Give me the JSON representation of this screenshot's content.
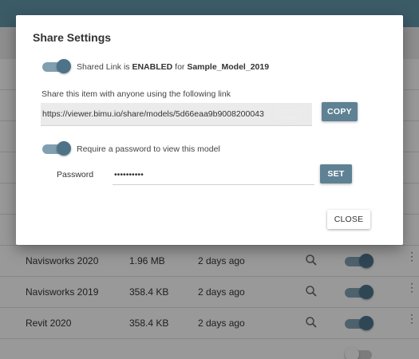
{
  "dialog": {
    "title": "Share Settings",
    "shared_status_prefix": "Shared Link is ",
    "shared_status_state": "ENABLED",
    "shared_status_mid": " for ",
    "model_name": "Sample_Model_2019",
    "share_hint": "Share this item with anyone using the following link",
    "share_link": "https://viewer.bimu.io/share/models/5d66eaa9b9008200043",
    "copy_label": "COPY",
    "password_toggle_label": "Require a password to view this model",
    "password_label": "Password",
    "password_value": "••••••••••",
    "set_label": "SET",
    "close_label": "CLOSE"
  },
  "background_rows": [
    {
      "name": "Navisworks 2020",
      "size": "1.96 MB",
      "date": "2 days ago",
      "toggle_on": true
    },
    {
      "name": "Navisworks 2019",
      "size": "358.4 KB",
      "date": "2 days ago",
      "toggle_on": true
    },
    {
      "name": "Revit 2020",
      "size": "358.4 KB",
      "date": "2 days ago",
      "toggle_on": true
    }
  ],
  "colors": {
    "accent": "#5f8194",
    "topbar": "#5f93a7",
    "toggle_thumb": "#4e7389",
    "toggle_track": "#809fb1",
    "dialog_bg": "#ffffff",
    "link_bg": "#ebebeb"
  },
  "icons": {
    "row_search": "magnifier-icon",
    "row_menu": "more-vertical-icon"
  },
  "toggles": {
    "shared_enabled": true,
    "password_required": true
  }
}
